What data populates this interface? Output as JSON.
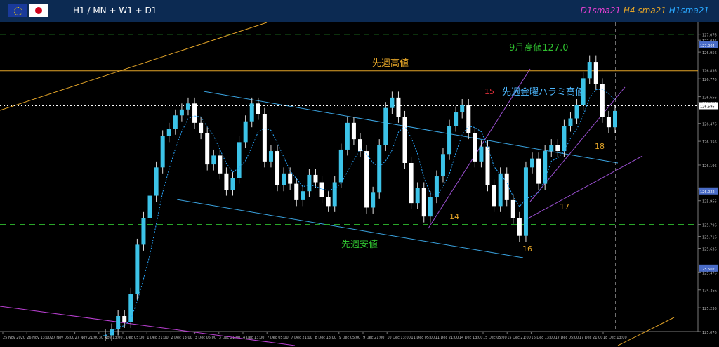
{
  "header": {
    "title": "H1 / MN + W1 + D1",
    "legend": [
      {
        "label": "D1sma21",
        "color": "#e23fd0"
      },
      {
        "label": "H4 sma21",
        "color": "#e3a428"
      },
      {
        "label": "H1sma21",
        "color": "#2aa8ff"
      }
    ],
    "flag_left": "eu-flag-icon",
    "flag_right": "japan-flag-icon"
  },
  "chart_data": {
    "type": "candlestick",
    "title": "",
    "ylim": [
      125.076,
      127.136
    ],
    "y_ticks": [
      "127.076",
      "127.036",
      "126.956",
      "126.836",
      "126.776",
      "126.656",
      "126.616",
      "126.476",
      "126.356",
      "126.196",
      "126.036",
      "125.956",
      "125.796",
      "125.716",
      "125.636",
      "125.476",
      "125.356",
      "125.236",
      "125.076"
    ],
    "x_ticks": [
      "25 Nov 2020",
      "26 Nov 13:00",
      "27 Nov 05:00",
      "27 Nov 21:00",
      "30 Nov 13:00",
      "1 Dec 05:00",
      "1 Dec 21:00",
      "2 Dec 13:00",
      "3 Dec 05:00",
      "3 Dec 21:00",
      "4 Dec 13:00",
      "7 Dec 05:00",
      "7 Dec 21:00",
      "8 Dec 13:00",
      "9 Dec 05:00",
      "9 Dec 21:00",
      "10 Dec 13:00",
      "11 Dec 05:00",
      "11 Dec 21:00",
      "14 Dec 13:00",
      "15 Dec 05:00",
      "15 Dec 21:00",
      "16 Dec 13:00",
      "17 Dec 05:00",
      "17 Dec 21:00",
      "18 Dec 13:00"
    ],
    "price_labels": [
      {
        "y": 127.004,
        "text": "127.004",
        "bg": "#4a6cc7",
        "fg": "#ffffff"
      },
      {
        "y": 126.595,
        "text": "126.595",
        "bg": "#ffffff",
        "fg": "#000000"
      },
      {
        "y": 126.022,
        "text": "126.022",
        "bg": "#4a6cc7",
        "fg": "#ffffff"
      },
      {
        "y": 125.502,
        "text": "125.502",
        "bg": "#4a6cc7",
        "fg": "#ffffff"
      }
    ],
    "levels": [
      {
        "y": 127.076,
        "color": "#2fbf2f",
        "dash": "8,6",
        "label": "9月高値127.0",
        "label_color": "#2fbf2f"
      },
      {
        "y": 126.83,
        "color": "#e3a428",
        "dash": "",
        "label": "先週高値",
        "label_color": "#e3a428"
      },
      {
        "y": 126.595,
        "color": "#ffffff",
        "dash": "2,3",
        "label": "先週金曜ハラミ高値",
        "label_color": "#4db8ff"
      },
      {
        "y": 125.796,
        "color": "#2fbf2f",
        "dash": "8,6",
        "label": "先週安値",
        "label_color": "#2fbf2f"
      }
    ],
    "annotations": [
      {
        "text": "15",
        "color": "#e0303a",
        "x": "14 Dec 13:00",
        "y": 126.66
      },
      {
        "text": "14",
        "color": "#e3a428",
        "x": "11 Dec 21:00",
        "y": 125.83
      },
      {
        "text": "16",
        "color": "#e3a428",
        "x": "15 Dec 21:00",
        "y": 125.63
      },
      {
        "text": "17",
        "color": "#e3a428",
        "x": "17 Dec 05:00",
        "y": 125.96
      },
      {
        "text": "18",
        "color": "#e3a428",
        "x": "18 Dec 13:00",
        "y": 126.31
      }
    ],
    "series": [
      {
        "name": "close",
        "values": [
          125.05,
          125.09,
          125.18,
          125.14,
          125.33,
          125.66,
          125.84,
          125.99,
          126.18,
          126.39,
          126.44,
          126.53,
          126.57,
          126.61,
          126.48,
          126.41,
          126.2,
          126.26,
          126.14,
          126.03,
          126.11,
          126.35,
          126.49,
          126.61,
          126.54,
          126.22,
          126.29,
          126.06,
          126.14,
          126.07,
          125.96,
          126.02,
          126.13,
          126.08,
          125.98,
          125.92,
          126.08,
          126.3,
          126.48,
          126.37,
          126.29,
          125.91,
          126.01,
          126.33,
          126.58,
          126.65,
          126.52,
          126.21,
          125.94,
          126.04,
          125.85,
          125.98,
          126.12,
          126.27,
          126.46,
          126.55,
          126.6,
          126.41,
          126.22,
          126.32,
          126.06,
          125.92,
          126.14,
          125.96,
          125.84,
          125.72,
          126.18,
          126.24,
          126.07,
          126.29,
          126.33,
          126.29,
          126.46,
          126.51,
          126.6,
          126.78,
          126.89,
          126.74,
          126.52,
          126.45,
          126.56
        ]
      }
    ]
  }
}
